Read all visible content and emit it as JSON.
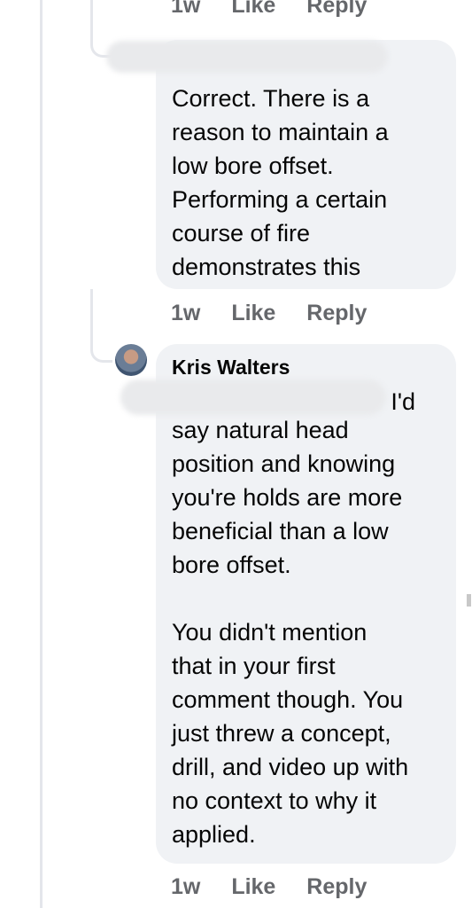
{
  "actions": {
    "time": "1w",
    "like": "Like",
    "reply": "Reply"
  },
  "comments": [
    {
      "text": "Correct. There is a\nreason to maintain a\nlow bore offset.\nPerforming a certain\ncourse of fire\ndemonstrates this"
    },
    {
      "author": "Kris Walters",
      "mention_tail": "I'd",
      "text": "say natural head\nposition and knowing\nyou're holds are more\nbeneficial than a low\nbore offset.\n\nYou didn't mention\nthat in your first\ncomment though. You\njust threw a concept,\ndrill, and video up with\nno context to why it\napplied."
    }
  ]
}
